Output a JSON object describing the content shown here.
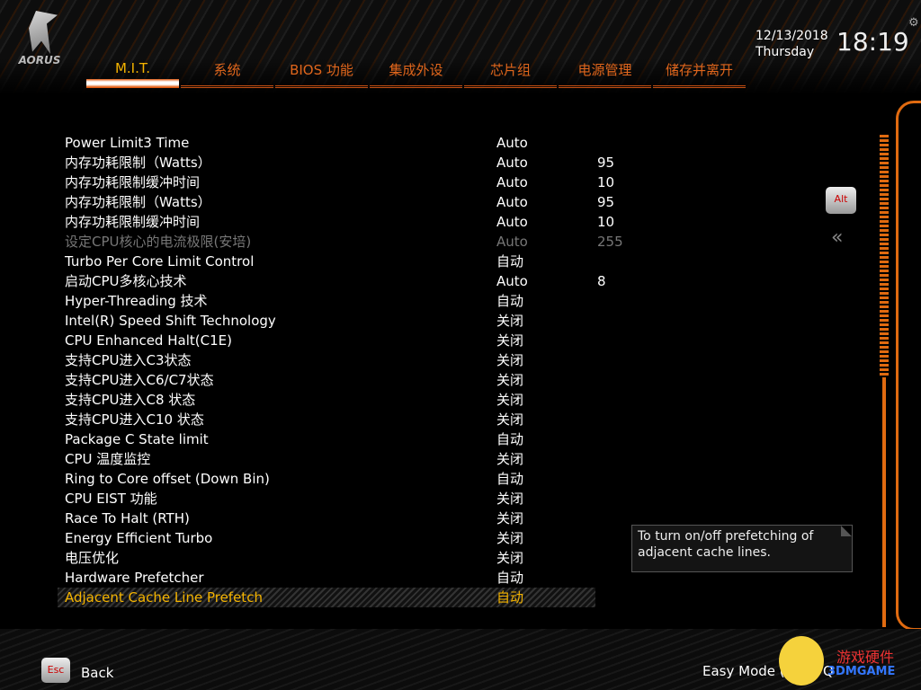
{
  "header": {
    "logo": "AORUS",
    "date": "12/13/2018",
    "day": "Thursday",
    "time": "18:19"
  },
  "tabs": [
    {
      "label": "M.I.T."
    },
    {
      "label": "系统"
    },
    {
      "label": "BIOS 功能"
    },
    {
      "label": "集成外设"
    },
    {
      "label": "芯片组"
    },
    {
      "label": "电源管理"
    },
    {
      "label": "储存并离开"
    }
  ],
  "settings": [
    {
      "label": "Power Limit3 Time",
      "value": "Auto",
      "num": ""
    },
    {
      "label": "内存功耗限制（Watts）",
      "value": "Auto",
      "num": "95"
    },
    {
      "label": "内存功耗限制缓冲时间",
      "value": "Auto",
      "num": "10"
    },
    {
      "label": "内存功耗限制（Watts）",
      "value": "Auto",
      "num": "95"
    },
    {
      "label": "内存功耗限制缓冲时间",
      "value": "Auto",
      "num": "10"
    },
    {
      "label": "设定CPU核心的电流极限(安培)",
      "value": "Auto",
      "num": "255"
    },
    {
      "label": "Turbo Per Core Limit Control",
      "value": "自动",
      "num": ""
    },
    {
      "label": "启动CPU多核心技术",
      "value": "Auto",
      "num": "8"
    },
    {
      "label": "Hyper-Threading 技术",
      "value": "自动",
      "num": ""
    },
    {
      "label": "Intel(R) Speed Shift Technology",
      "value": "关闭",
      "num": ""
    },
    {
      "label": "CPU Enhanced Halt(C1E)",
      "value": "关闭",
      "num": ""
    },
    {
      "label": "支持CPU进入C3状态",
      "value": "关闭",
      "num": ""
    },
    {
      "label": "支持CPU进入C6/C7状态",
      "value": "关闭",
      "num": ""
    },
    {
      "label": "支持CPU进入C8 状态",
      "value": "关闭",
      "num": ""
    },
    {
      "label": "支持CPU进入C10 状态",
      "value": "关闭",
      "num": ""
    },
    {
      "label": "Package C State limit",
      "value": "自动",
      "num": ""
    },
    {
      "label": "CPU 温度监控",
      "value": "关闭",
      "num": ""
    },
    {
      "label": "Ring to Core offset (Down Bin)",
      "value": "自动",
      "num": ""
    },
    {
      "label": "CPU EIST 功能",
      "value": "关闭",
      "num": ""
    },
    {
      "label": "Race To Halt (RTH)",
      "value": "关闭",
      "num": ""
    },
    {
      "label": "Energy Efficient Turbo",
      "value": "关闭",
      "num": ""
    },
    {
      "label": "电压优化",
      "value": "关闭",
      "num": ""
    },
    {
      "label": "Hardware Prefetcher",
      "value": "自动",
      "num": ""
    },
    {
      "label": "Adjacent Cache Line Prefetch",
      "value": "自动",
      "num": ""
    }
  ],
  "help": "To turn on/off prefetching of adjacent cache lines.",
  "side": {
    "alt": "Alt",
    "collapse": "«"
  },
  "footer": {
    "esc": "Esc",
    "back": "Back",
    "easy": "Easy Mode (",
    "qflash": "Q"
  },
  "watermark": {
    "cn": "游戏硬件",
    "en": "3DMGAME"
  }
}
